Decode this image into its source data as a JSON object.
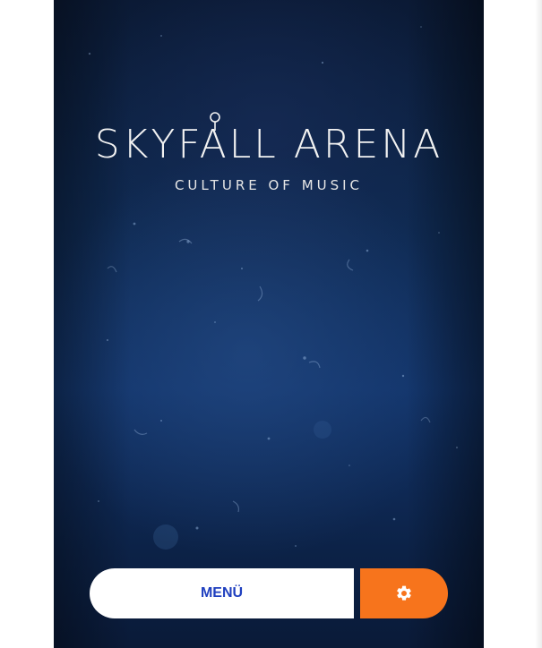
{
  "brand": {
    "title": "SKYFALL ARENA",
    "subtitle": "CULTURE OF MUSIC"
  },
  "bottom_bar": {
    "menu_label": "MENÜ",
    "settings_icon": "gear-icon"
  },
  "colors": {
    "background_dark": "#0f2a52",
    "menu_text": "#1f3fbf",
    "settings_bg": "#f7741c",
    "button_bg": "#ffffff"
  }
}
